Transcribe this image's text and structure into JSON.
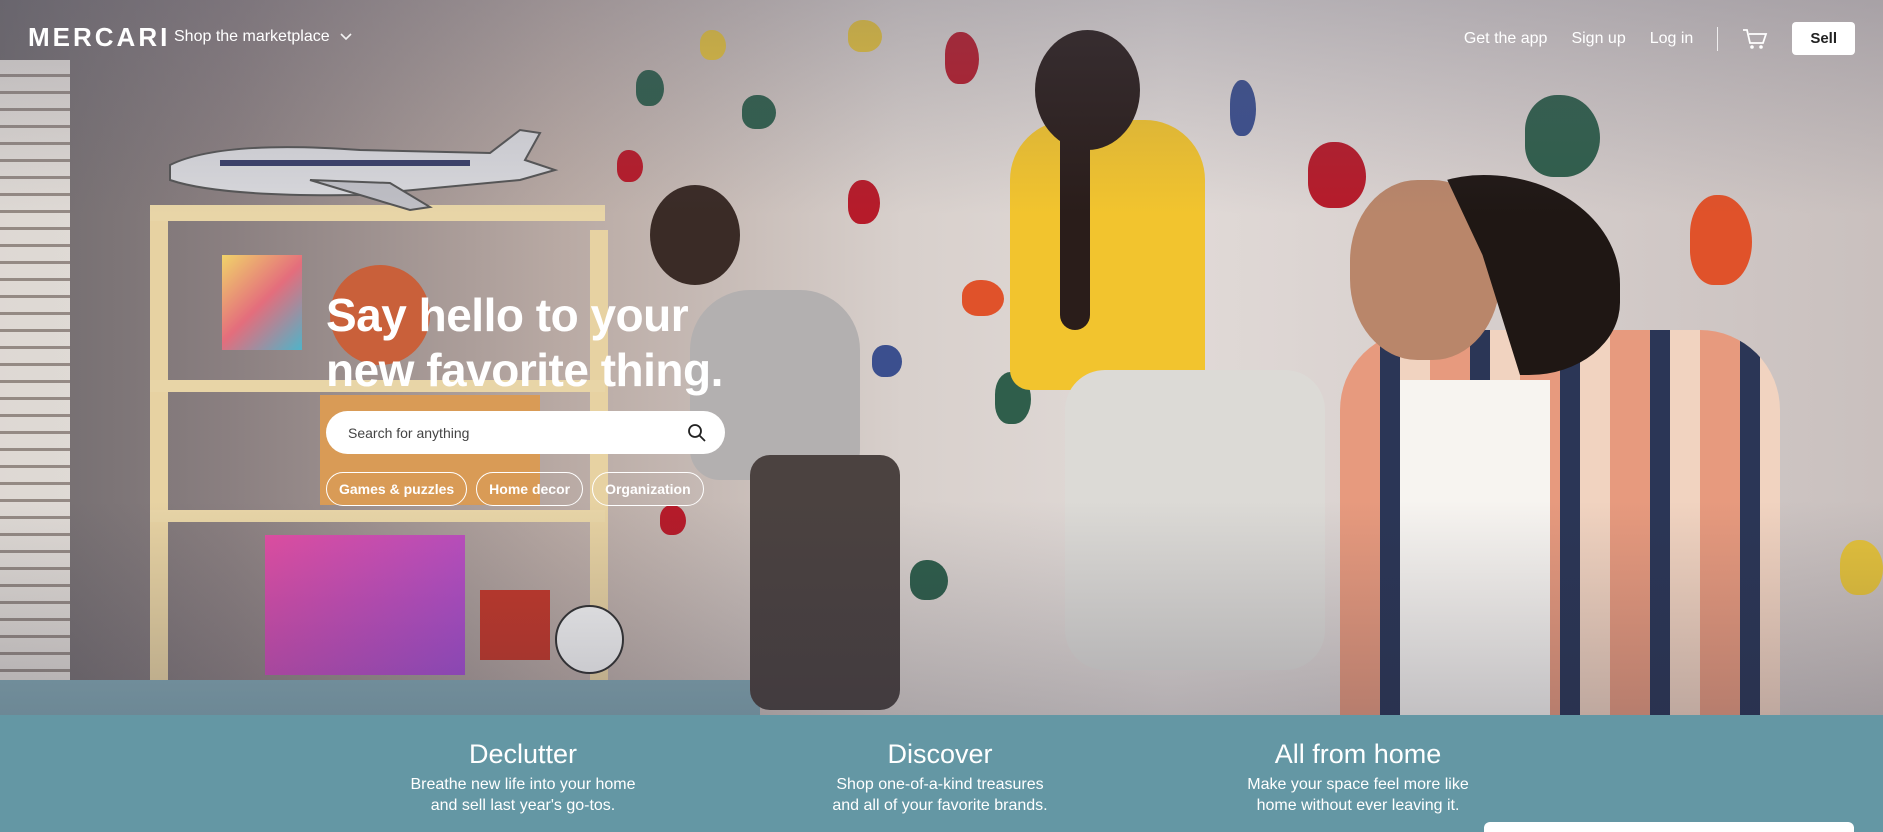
{
  "header": {
    "logo": "MERCARI",
    "shop_menu_label": "Shop the marketplace",
    "links": [
      "Get the app",
      "Sign up",
      "Log in"
    ],
    "sell_label": "Sell"
  },
  "hero": {
    "headline_line1": "Say hello to your",
    "headline_line2": "new favorite thing.",
    "search_placeholder": "Search for anything",
    "chips": [
      "Games & puzzles",
      "Home decor",
      "Organization"
    ]
  },
  "features": [
    {
      "title": "Declutter",
      "desc_line1": "Breathe new life into your home",
      "desc_line2": "and sell last year's go-tos."
    },
    {
      "title": "Discover",
      "desc_line1": "Shop one-of-a-kind treasures",
      "desc_line2": "and all of your favorite brands."
    },
    {
      "title": "All from home",
      "desc_line1": "Make your space feel more like",
      "desc_line2": "home without ever leaving it."
    }
  ],
  "icons": {
    "chevron": "chevron-down-icon",
    "cart": "cart-icon",
    "search": "search-icon"
  },
  "colors": {
    "band": "#6497a4",
    "hero_text": "#ffffff",
    "sell_bg": "#ffffff"
  }
}
